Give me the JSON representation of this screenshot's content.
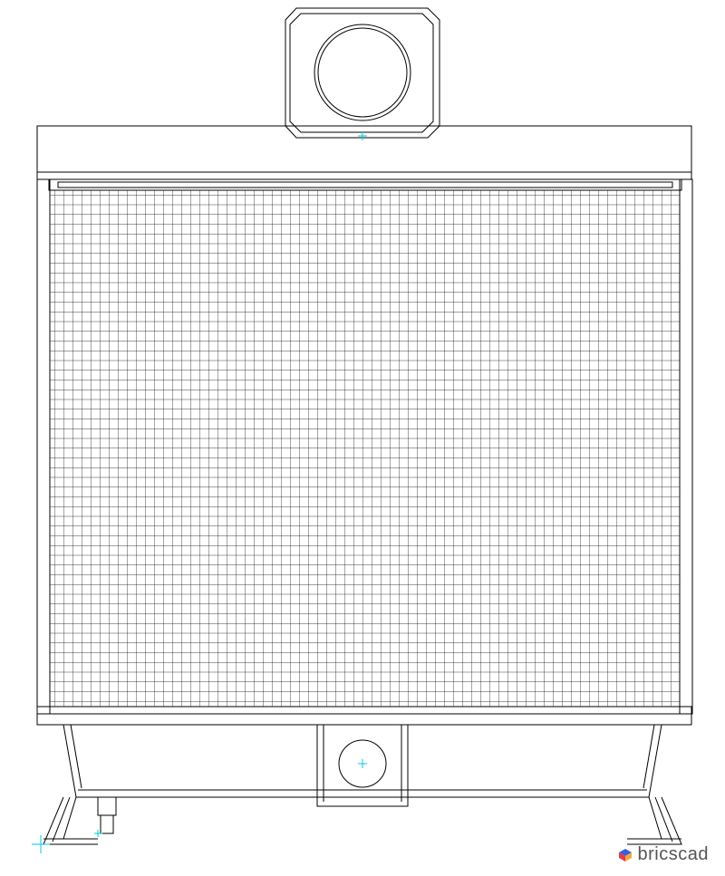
{
  "watermark": {
    "label": "bricscad"
  },
  "drawing": {
    "subject": "radiator-front-view",
    "stroke_color": "#000000",
    "marker_color": "#00C8E6",
    "grid": {
      "cols": 70,
      "rows": 53
    }
  }
}
